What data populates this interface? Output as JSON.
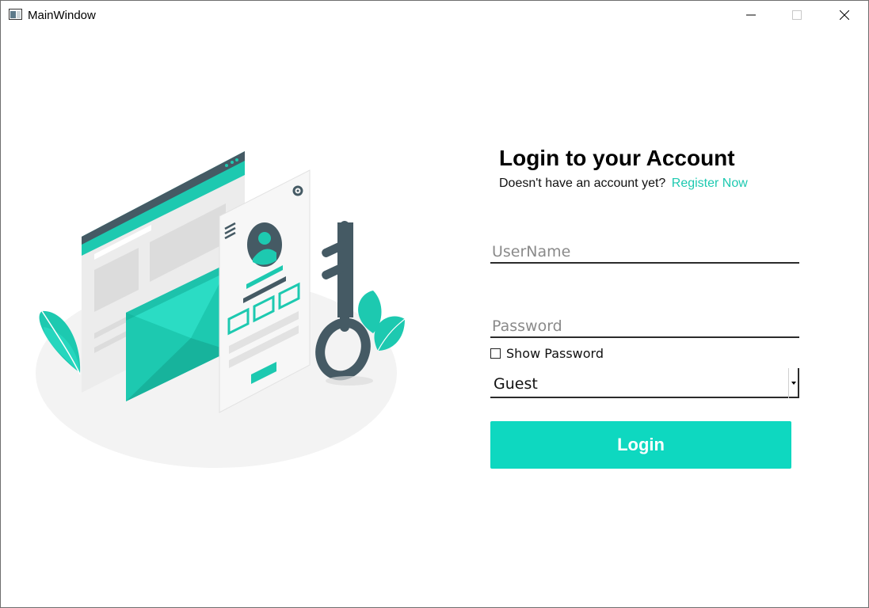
{
  "window": {
    "title": "MainWindow",
    "controls": {
      "minimize": "minimize-icon",
      "maximize": "maximize-icon",
      "close": "close-icon"
    }
  },
  "login": {
    "title": "Login to your Account",
    "register_prompt": "Doesn't have an account yet?",
    "register_link": "Register Now",
    "username_placeholder": "UserName",
    "username_value": "",
    "password_placeholder": "Password",
    "password_value": "",
    "show_password_label": "Show Password",
    "show_password_checked": false,
    "role_selected": "Guest",
    "submit_label": "Login"
  },
  "colors": {
    "accent": "#0ed8c0",
    "link": "#1dc9b0",
    "dark": "#455a64"
  },
  "illustration": {
    "icons": [
      "browser-window-icon",
      "envelope-icon",
      "profile-card-icon",
      "key-icon",
      "leaf-icon",
      "gear-icon",
      "avatar-icon"
    ]
  }
}
